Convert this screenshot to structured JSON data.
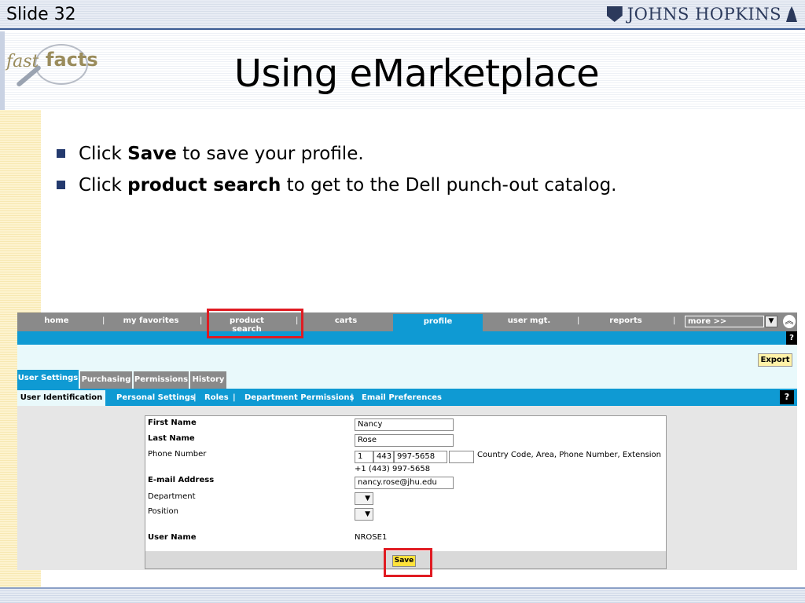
{
  "slide": {
    "number": "Slide 32",
    "brand": "JOHNS HOPKINS",
    "fastfacts_fast": "fast",
    "fastfacts_facts": "facts",
    "title": "Using eMarketplace",
    "bullets": [
      {
        "pre": "Click ",
        "bold": "Save",
        "post": " to save your profile."
      },
      {
        "pre": "Click ",
        "bold": "product search",
        "post": " to get to the Dell punch-out catalog."
      }
    ]
  },
  "app": {
    "nav": {
      "home": "home",
      "my_favorites": "my favorites",
      "product_search": "product search",
      "carts": "carts",
      "profile": "profile",
      "user_mgt": "user mgt.",
      "reports": "reports",
      "more": "more >>",
      "sep": "|"
    },
    "help": "?",
    "export": "Export",
    "tabs": {
      "user_settings": "User Settings",
      "purchasing": "Purchasing",
      "permissions": "Permissions",
      "history": "History"
    },
    "subnav": {
      "user_identification": "User Identification",
      "personal_settings": "Personal Settings",
      "roles": "Roles",
      "department_permissions": "Department Permissions",
      "email_preferences": "Email Preferences",
      "sep": "|"
    },
    "form": {
      "first_name_label": "First Name",
      "first_name": "Nancy",
      "last_name_label": "Last Name",
      "last_name": "Rose",
      "phone_label": "Phone Number",
      "phone_country": "1",
      "phone_area": "443",
      "phone_number": "997-5658",
      "phone_extension": "",
      "phone_hint": "Country Code, Area, Phone Number, Extension",
      "phone_formatted": "+1 (443) 997-5658",
      "email_label": "E-mail Address",
      "email": "nancy.rose@jhu.edu",
      "department_label": "Department",
      "position_label": "Position",
      "username_label": "User Name",
      "username": "NROSE1",
      "save": "Save"
    }
  },
  "colors": {
    "nav_gray": "#8a8a8a",
    "accent_blue": "#0f9ad3",
    "highlight_red": "#e01b22",
    "save_yellow": "#ffe23b"
  }
}
